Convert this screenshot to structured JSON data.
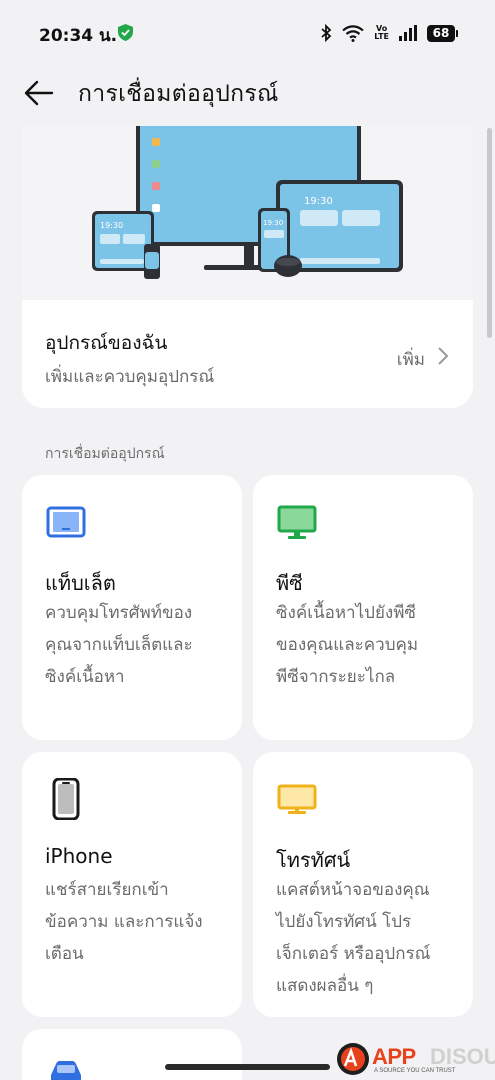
{
  "status_bar": {
    "time": "20:34 น.",
    "volte": "Vo LTE",
    "battery": "68"
  },
  "app_bar": {
    "title": "การเชื่อมต่ออุปกรณ์"
  },
  "hero_illustration": {
    "tablet_time": "19:30",
    "phone_time": "19:30",
    "small_tablet_time": "19:30"
  },
  "my_devices": {
    "title": "อุปกรณ์ของฉัน",
    "subtitle": "เพิ่มและควบคุมอุปกรณ์",
    "action_label": "เพิ่ม"
  },
  "section": {
    "label": "การเชื่อมต่ออุปกรณ์"
  },
  "cards": [
    {
      "title": "แท็บเล็ต",
      "desc": [
        "ควบคุมโทรศัพท์ของ",
        "คุณจากแท็บเล็ตและ",
        "ซิงค์เนื้อหา"
      ],
      "icon": "tablet-icon",
      "color": "#2f6fe0"
    },
    {
      "title": "พีซี",
      "desc": [
        "ซิงค์เนื้อหาไปยังพีซี",
        "ของคุณและควบคุม",
        "พีซีจากระยะไกล"
      ],
      "icon": "pc-icon",
      "color": "#22a84a"
    },
    {
      "title": "iPhone",
      "desc": [
        "แชร์สายเรียกเข้า",
        "ข้อความ และการแจ้ง",
        "เตือน"
      ],
      "icon": "iphone-icon",
      "color": "#1a1a1a"
    },
    {
      "title": "โทรทัศน์",
      "desc": [
        "แคสต์หน้าจอของคุณ",
        "ไปยังโทรทัศน์ โปร",
        "เจ็กเตอร์ หรืออุปกรณ์",
        "แสดงผลอื่น ๆ"
      ],
      "icon": "tv-icon",
      "color": "#f0b21a"
    },
    {
      "icon": "car-icon",
      "color": "#2f6fe0"
    }
  ],
  "watermark": {
    "brand_a": "APP",
    "brand_b": "DISOUS",
    "tagline": "A SOURCE YOU CAN TRUST"
  }
}
